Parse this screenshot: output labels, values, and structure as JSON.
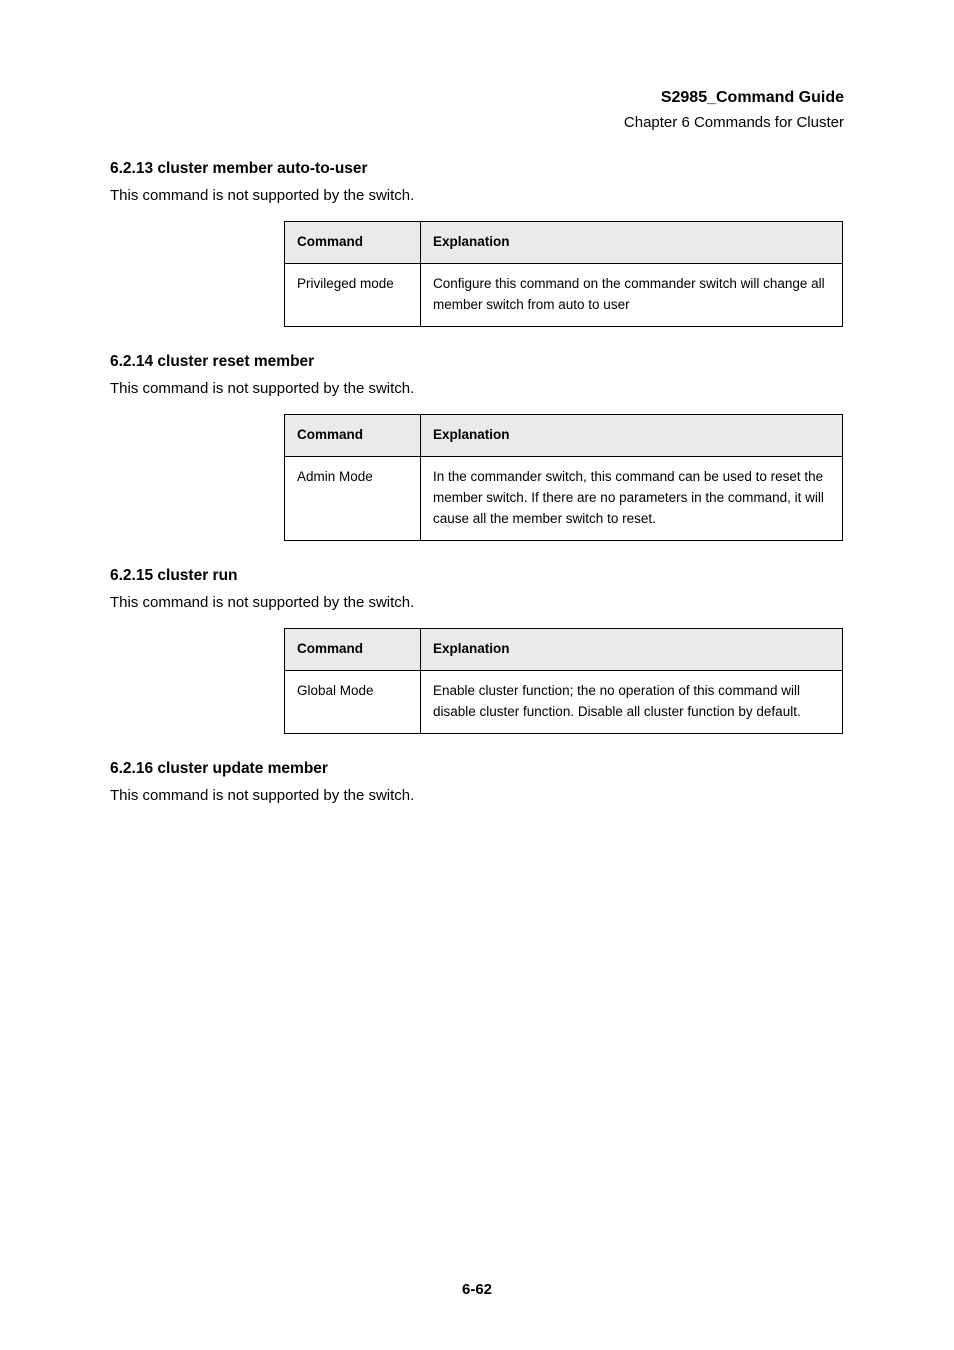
{
  "header": {
    "product": "S2985_Command Guide",
    "chapter": "Chapter 6 Commands for Cluster"
  },
  "sections": [
    {
      "heading": "6.2.13 cluster member auto-to-user",
      "body": "This command is not supported by the switch.",
      "table": {
        "head": {
          "col1": "Command",
          "col2": "Explanation"
        },
        "row": {
          "col1": "Privileged mode",
          "col2": "Configure this command on the commander switch will change all member switch from auto to user"
        }
      }
    },
    {
      "heading": "6.2.14 cluster reset member",
      "body": "This command is not supported by the switch.",
      "table": {
        "head": {
          "col1": "Command",
          "col2": "Explanation"
        },
        "row": {
          "col1": "Admin Mode",
          "col2": "In the commander switch, this command can be used to reset the member switch. If there are no parameters in the command, it will cause all the member switch to reset."
        }
      }
    },
    {
      "heading": "6.2.15 cluster run",
      "body": "This command is not supported by the switch.",
      "table": {
        "head": {
          "col1": "Command",
          "col2": "Explanation"
        },
        "row": {
          "col1": "Global Mode",
          "col2": "Enable cluster function; the no operation of this command will disable cluster function. Disable all cluster function by default."
        }
      }
    },
    {
      "heading": "6.2.16 cluster update member",
      "body": "This command is not supported by the switch."
    }
  ],
  "page_number": "6-62"
}
